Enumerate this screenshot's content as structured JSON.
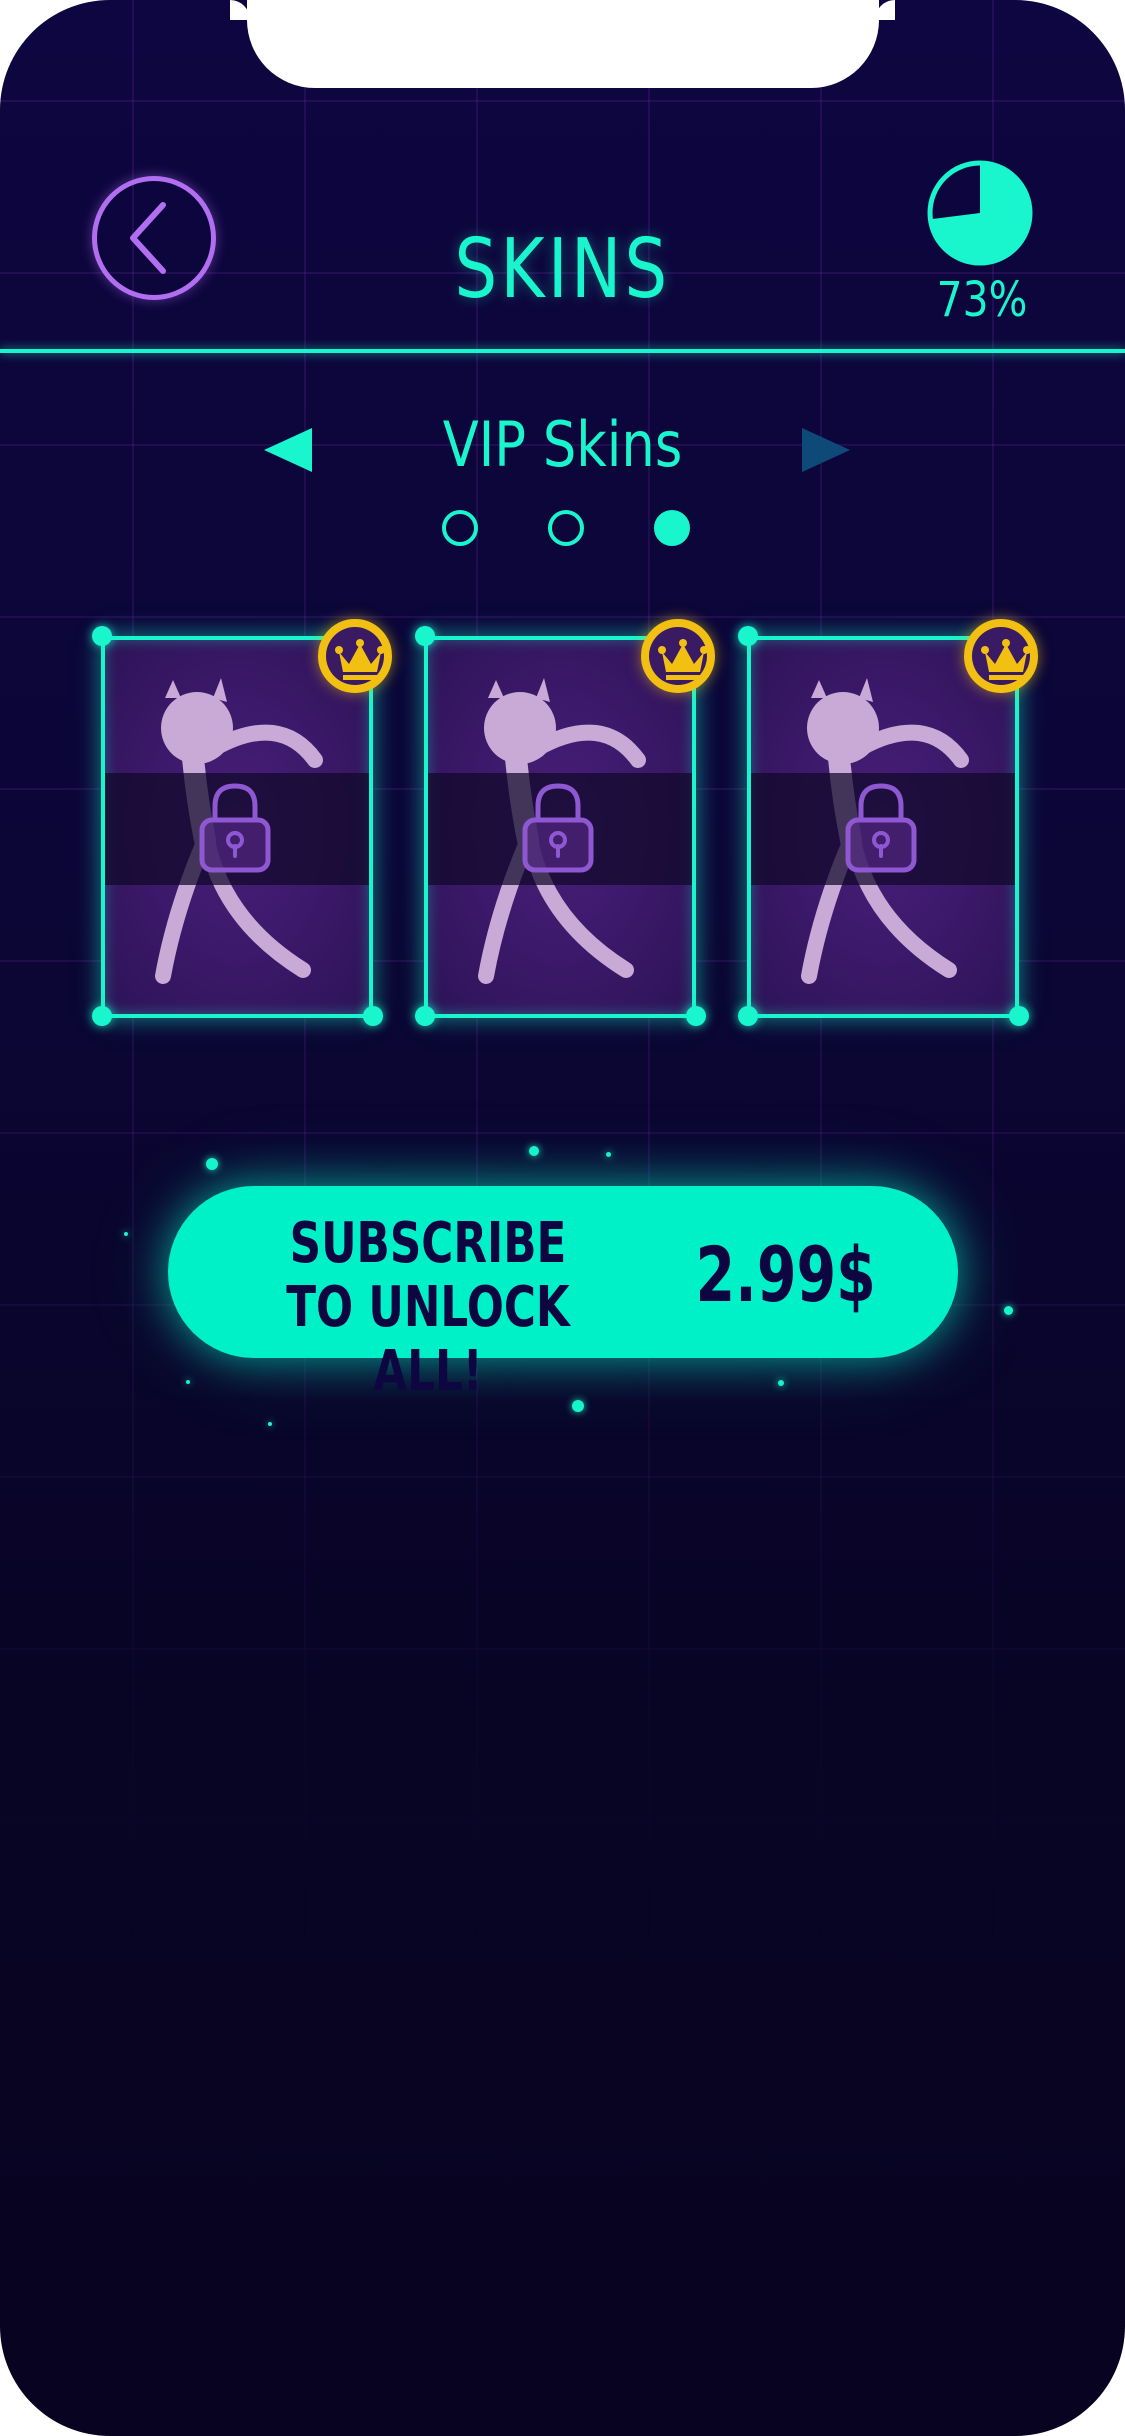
{
  "header": {
    "title": "SKINS",
    "progress_text": "73%",
    "progress_value": 0.73
  },
  "section": {
    "title": "VIP Skins",
    "page_count": 3,
    "active_page": 3
  },
  "skins": [
    {
      "name": "devil-stickman",
      "locked": true,
      "vip": true
    },
    {
      "name": "devil-stickman",
      "locked": true,
      "vip": true
    },
    {
      "name": "devil-stickman",
      "locked": true,
      "vip": true
    }
  ],
  "subscribe": {
    "line1": "SUBSCRIBE",
    "line2": "TO UNLOCK ALL!",
    "price": "2.99$"
  },
  "icons": {
    "back": "chevron-left-icon",
    "progress": "pie-progress-icon",
    "prev": "triangle-left-icon",
    "next": "triangle-right-icon",
    "crown": "crown-icon",
    "lock": "lock-icon"
  },
  "colors": {
    "accent": "#19f5cc",
    "back_button": "#b26ef0",
    "background": "#0d0640",
    "crown": "#f2c013",
    "button": "#00f0c8",
    "next_arrow_dim": "#0e4a78"
  }
}
